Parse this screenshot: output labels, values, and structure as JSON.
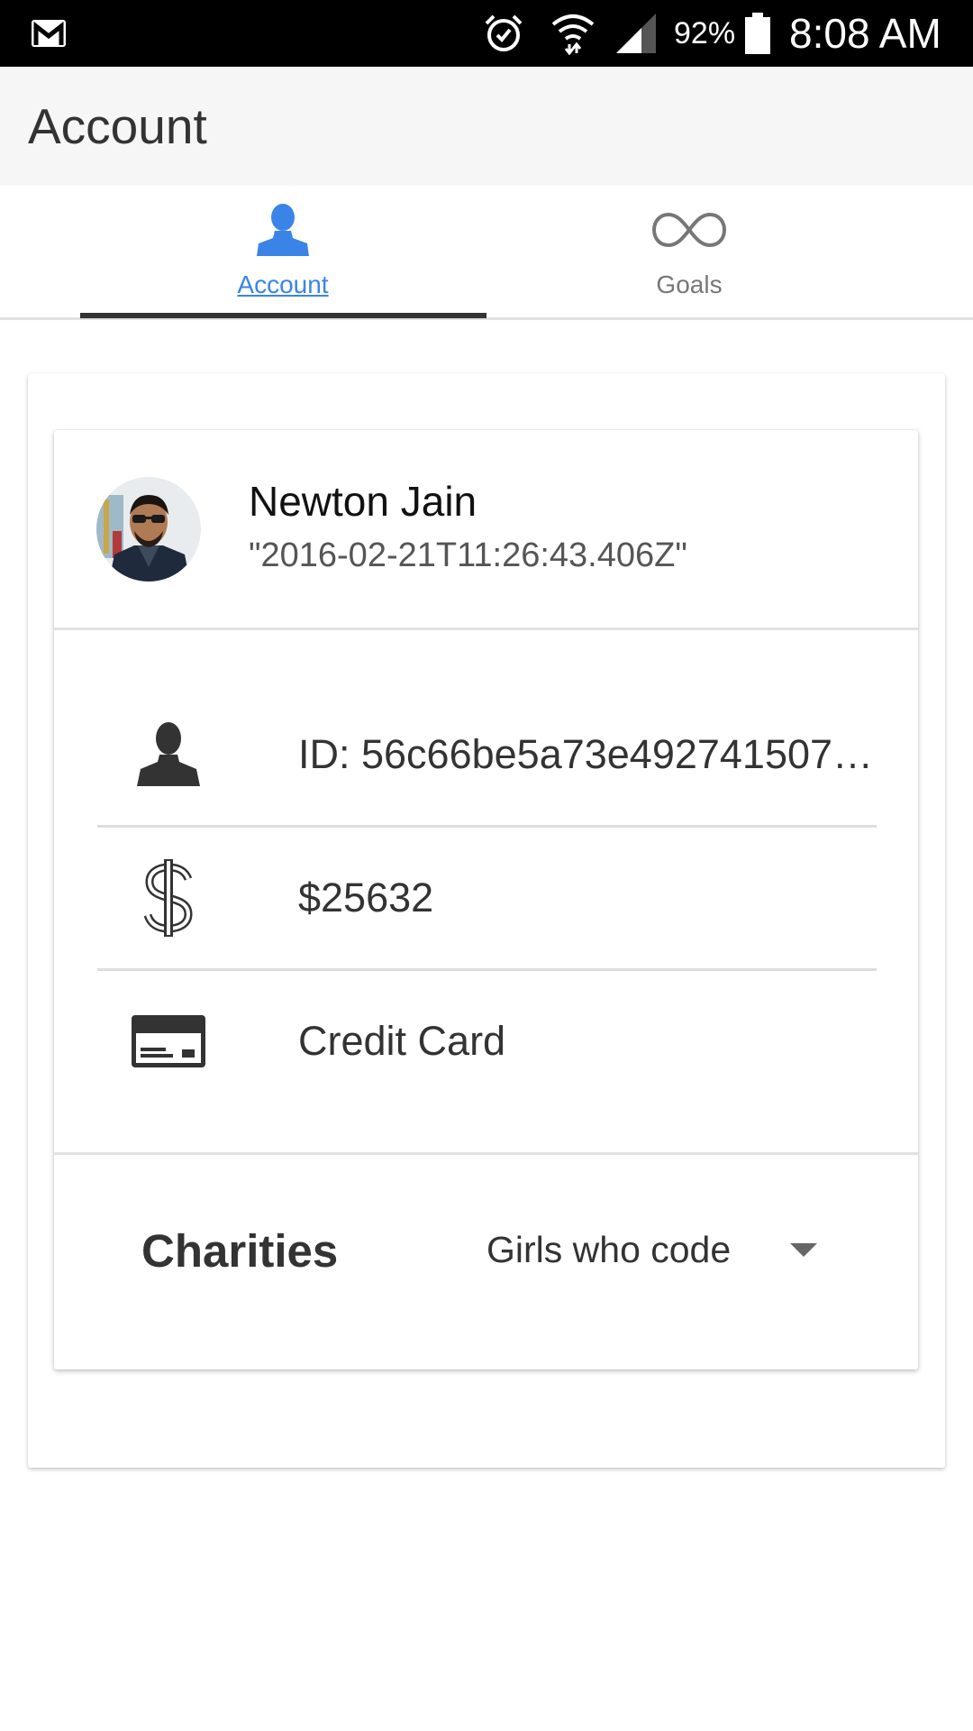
{
  "status_bar": {
    "battery": "92%",
    "time": "8:08 AM",
    "icons": [
      "gmail-icon",
      "alarm-icon",
      "wifi-icon",
      "signal-icon",
      "battery-icon"
    ]
  },
  "app_bar": {
    "title": "Account"
  },
  "tabs": [
    {
      "label": "Account",
      "icon": "person-icon",
      "selected": true
    },
    {
      "label": "Goals",
      "icon": "infinity-icon",
      "selected": false
    }
  ],
  "profile": {
    "name": "Newton Jain",
    "date": "\"2016-02-21T11:26:43.406Z\""
  },
  "info": {
    "id": "ID: 56c66be5a73e492741507…",
    "balance": "$25632",
    "payment": "Credit Card"
  },
  "charities": {
    "label": "Charities",
    "selected": "Girls who code"
  },
  "colors": {
    "accent": "#3a84e8",
    "status_bar": "#000000",
    "app_bar": "#f6f6f6",
    "tab_indicator": "#333333"
  }
}
